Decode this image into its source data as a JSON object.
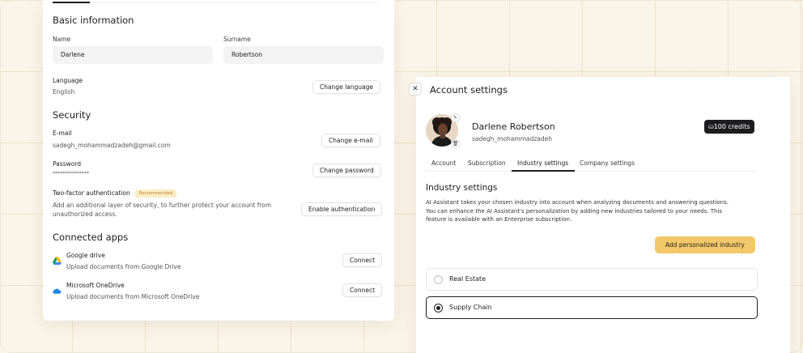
{
  "basic": {
    "title": "Basic information",
    "name_label": "Name",
    "name_value": "Darlene",
    "surname_label": "Surname",
    "surname_value": "Robertson",
    "language_label": "Language",
    "language_value": "English",
    "change_language": "Change language"
  },
  "security": {
    "title": "Security",
    "email_label": "E-mail",
    "email_value": "sadegh_mohammadzadeh@gmail.com",
    "change_email": "Change e-mail",
    "password_label": "Password",
    "password_value": "***************",
    "change_password": "Change password",
    "twofa_label": "Two-factor authentication",
    "twofa_badge": "Recommended",
    "twofa_desc_1": "Add an additional layer of security, to further protect your account from",
    "twofa_desc_2": "unauthorized access.",
    "enable_auth": "Enable authentication"
  },
  "connected": {
    "title": "Connected apps",
    "apps": [
      {
        "name": "Google drive",
        "desc": "Upload documents from Google Drive",
        "button": "Connect",
        "icon": "google-drive-icon"
      },
      {
        "name": "Microsoft OneDrive",
        "desc": "Upload documents from Microsoft OneDrive",
        "button": "Connect",
        "icon": "onedrive-icon"
      }
    ]
  },
  "modal": {
    "title": "Account settings",
    "close_icon": "close-icon",
    "profile_name": "Darlene Robertson",
    "username": "sadegh_mohammadzadeh",
    "credits": "100 credits",
    "tabs": [
      {
        "label": "Account"
      },
      {
        "label": "Subscription"
      },
      {
        "label": "Industry settings"
      },
      {
        "label": "Company settings"
      }
    ],
    "active_tab": "Industry settings",
    "section_title": "Industry settings",
    "desc_1": "AI Assistant takes your chosen industry into account when analyzing documents and answering questions.",
    "desc_2": "You can enhance the AI Assistant's personalization by adding new industries tailored to your needs. This",
    "desc_3": "feature is available with an Enterprise subscription.",
    "add_button": "Add personalized industry",
    "options": [
      {
        "label": "Real Estate",
        "selected": false
      },
      {
        "label": "Supply Chain",
        "selected": true
      }
    ]
  },
  "colors": {
    "accent": "#f2c86b",
    "dark": "#1d1d1f",
    "badge_bg": "#fbecc4",
    "badge_text": "#b9862a",
    "background": "#fbf5e9"
  }
}
